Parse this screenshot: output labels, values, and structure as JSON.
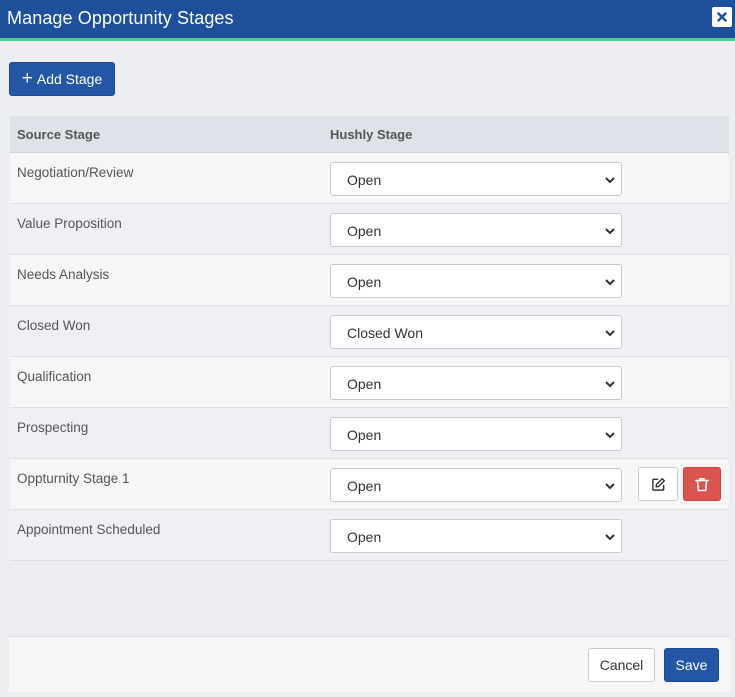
{
  "dialog": {
    "title": "Manage Opportunity Stages",
    "close_icon": "close-icon",
    "accent_color": "#1e4f9a"
  },
  "toolbar": {
    "add_stage_label": "Add Stage",
    "add_icon": "plus-icon"
  },
  "table": {
    "headers": {
      "source": "Source Stage",
      "hushly": "Hushly Stage"
    },
    "rows": [
      {
        "source": "Negotiation/Review",
        "hushly": "Open"
      },
      {
        "source": "Value Proposition",
        "hushly": "Open"
      },
      {
        "source": "Needs Analysis",
        "hushly": "Open"
      },
      {
        "source": "Closed Won",
        "hushly": "Closed Won"
      },
      {
        "source": "Qualification",
        "hushly": "Open"
      },
      {
        "source": "Prospecting",
        "hushly": "Open"
      },
      {
        "source": "Oppturnity Stage 1",
        "hushly": "Open",
        "editable": true
      },
      {
        "source": "Appointment Scheduled",
        "hushly": "Open"
      }
    ]
  },
  "footer": {
    "cancel_label": "Cancel",
    "save_label": "Save"
  }
}
